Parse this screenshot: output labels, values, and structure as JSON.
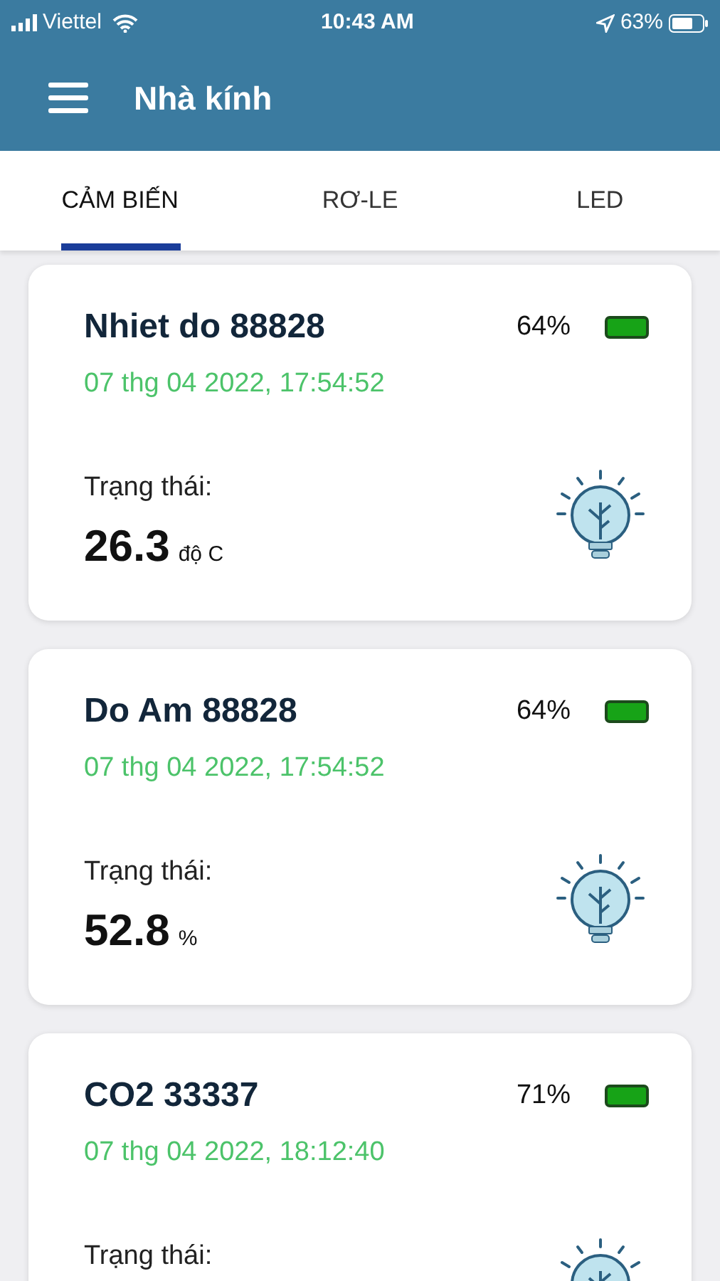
{
  "status_bar": {
    "carrier": "Viettel",
    "time": "10:43 AM",
    "battery": "63%"
  },
  "header": {
    "title": "Nhà kính"
  },
  "tabs": [
    {
      "label": "CẢM BIẾN",
      "selected": true
    },
    {
      "label": "RƠ-LE",
      "selected": false
    },
    {
      "label": "LED",
      "selected": false
    }
  ],
  "sensors": [
    {
      "name": "Nhiet do 88828",
      "battery": "64%",
      "timestamp": "07 thg 04 2022, 17:54:52",
      "status_label": "Trạng thái:",
      "value": "26.3",
      "unit": "độ C"
    },
    {
      "name": "Do Am 88828",
      "battery": "64%",
      "timestamp": "07 thg 04 2022, 17:54:52",
      "status_label": "Trạng thái:",
      "value": "52.8",
      "unit": "%"
    },
    {
      "name": "CO2 33337",
      "battery": "71%",
      "timestamp": "07 thg 04 2022, 18:12:40",
      "status_label": "Trạng thái:"
    }
  ]
}
